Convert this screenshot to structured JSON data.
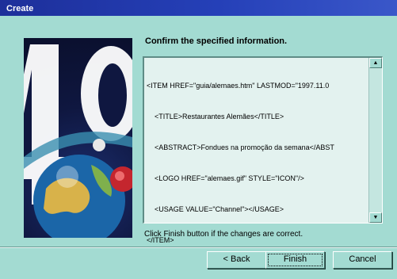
{
  "window": {
    "title": "Create"
  },
  "main": {
    "heading": "Confirm the specified information.",
    "code_lines": [
      "<ITEM HREF=\"guia/alemaes.htm\" LASTMOD=\"1997.11.0",
      "    <TITLE>Restaurantes Alemães</TITLE>",
      "    <ABSTRACT>Fondues na promoção da semana</ABST",
      "    <LOGO HREF=\"alemaes.gif\" STYLE=\"ICON\"/>",
      "    <USAGE VALUE=\"Channel\"></USAGE>",
      "</ITEM>"
    ],
    "hint": "Click Finish button if the changes are correct."
  },
  "buttons": {
    "back_label": "< Back",
    "finish_label": "Finish",
    "cancel_label": "Cancel"
  },
  "icons": {
    "scroll_up": "arrow-up-icon",
    "scroll_down": "arrow-down-icon"
  },
  "colors": {
    "title_bar": "#1d2f9a",
    "dialog_bg": "#a3dbd2"
  }
}
